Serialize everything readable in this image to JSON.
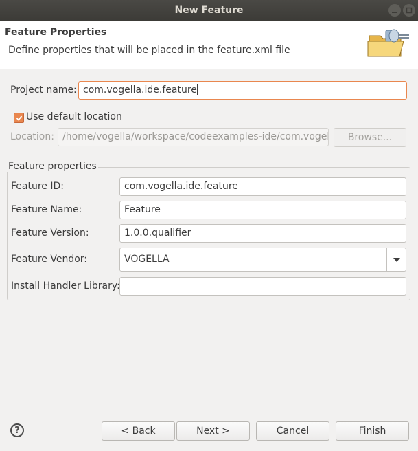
{
  "window": {
    "title": "New Feature"
  },
  "header": {
    "title": "Feature Properties",
    "description": "Define properties that will be placed in the feature.xml file",
    "icon": "folder-plugin-icon"
  },
  "project": {
    "label": "Project name:",
    "value": "com.vogella.ide.feature"
  },
  "use_default_location": {
    "label": "Use default location",
    "checked": true
  },
  "location": {
    "label": "Location:",
    "value": "/home/vogella/workspace/codeexamples-ide/com.vogel",
    "browse_label": "Browse..."
  },
  "feature_properties": {
    "title": "Feature properties",
    "id": {
      "label": "Feature ID:",
      "value": "com.vogella.ide.feature"
    },
    "name": {
      "label": "Feature Name:",
      "value": "Feature"
    },
    "version": {
      "label": "Feature Version:",
      "value": "1.0.0.qualifier"
    },
    "vendor": {
      "label": "Feature Vendor:",
      "value": "VOGELLA"
    },
    "install_handler": {
      "label": "Install Handler Library:",
      "value": ""
    }
  },
  "buttons": {
    "help": "?",
    "back": "< Back",
    "next": "Next >",
    "cancel": "Cancel",
    "finish": "Finish"
  },
  "colors": {
    "accent": "#e9874f",
    "titlebar": "#3c3b37",
    "background": "#f2f1f0"
  }
}
